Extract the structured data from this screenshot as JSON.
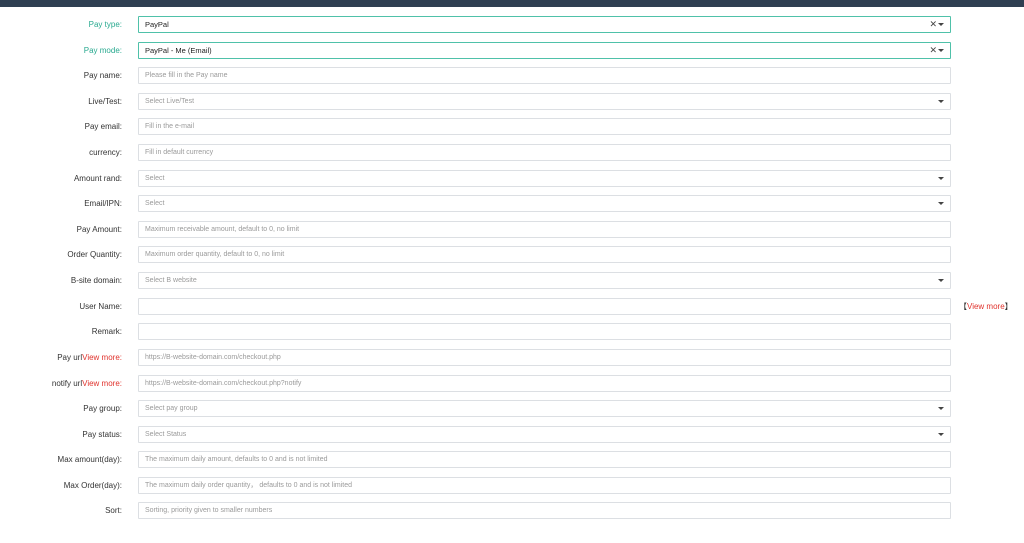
{
  "form": {
    "rows": [
      {
        "label": "Pay type:",
        "value": "PayPal",
        "type": "select",
        "clearable": true
      },
      {
        "label": "Pay mode:",
        "value": "PayPal - Me (Email)",
        "type": "select",
        "clearable": true
      },
      {
        "label": "Pay name:",
        "placeholder": "Please fill in the Pay name",
        "type": "input"
      },
      {
        "label": "Live/Test:",
        "placeholder": "Select Live/Test",
        "type": "select"
      },
      {
        "label": "Pay email:",
        "placeholder": "Fill in the e-mail",
        "type": "input"
      },
      {
        "label": "currency:",
        "placeholder": "Fill in default currency",
        "type": "input"
      },
      {
        "label": "Amount rand:",
        "placeholder": "Select",
        "type": "select"
      },
      {
        "label": "Email/IPN:",
        "placeholder": "Select",
        "type": "select"
      },
      {
        "label": "Pay Amount:",
        "placeholder": "Maximum receivable amount, default to 0, no limit",
        "type": "input"
      },
      {
        "label": "Order Quantity:",
        "placeholder": "Maximum order quantity, default to 0, no limit",
        "type": "input"
      },
      {
        "label": "B-site domain:",
        "placeholder": "Select B website",
        "type": "select"
      },
      {
        "label": "User Name:",
        "placeholder": "",
        "type": "input"
      },
      {
        "label": "Remark:",
        "placeholder": "",
        "type": "input"
      },
      {
        "label": "Pay url",
        "link": "View more:",
        "placeholder": "https://B-website-domain.com/checkout.php",
        "type": "input"
      },
      {
        "label": "notify url",
        "link": "View more:",
        "placeholder": "https://B-website-domain.com/checkout.php?notify",
        "type": "input"
      },
      {
        "label": "Pay group:",
        "placeholder": "Select pay group",
        "type": "select"
      },
      {
        "label": "Pay status:",
        "placeholder": "Select Status",
        "type": "select"
      },
      {
        "label": "Max amount(day):",
        "placeholder": "The maximum daily amount,  defaults to 0 and is not limited",
        "type": "input"
      },
      {
        "label": "Max Order(day):",
        "placeholder": "The maximum daily order quantity， defaults to 0 and is not limited",
        "type": "input"
      },
      {
        "label": "Sort:",
        "placeholder": "Sorting, priority given to smaller numbers",
        "type": "input"
      }
    ],
    "username_aside": {
      "open": "【",
      "link": "View more",
      "close": "】"
    },
    "icons": {
      "clear": "close-icon",
      "caret": "caret-down-icon"
    }
  },
  "colors": {
    "topbar": "#2f3f52",
    "accent": "#28a98f",
    "active_border": "#4fc1a9",
    "link_red": "#e0322c"
  }
}
